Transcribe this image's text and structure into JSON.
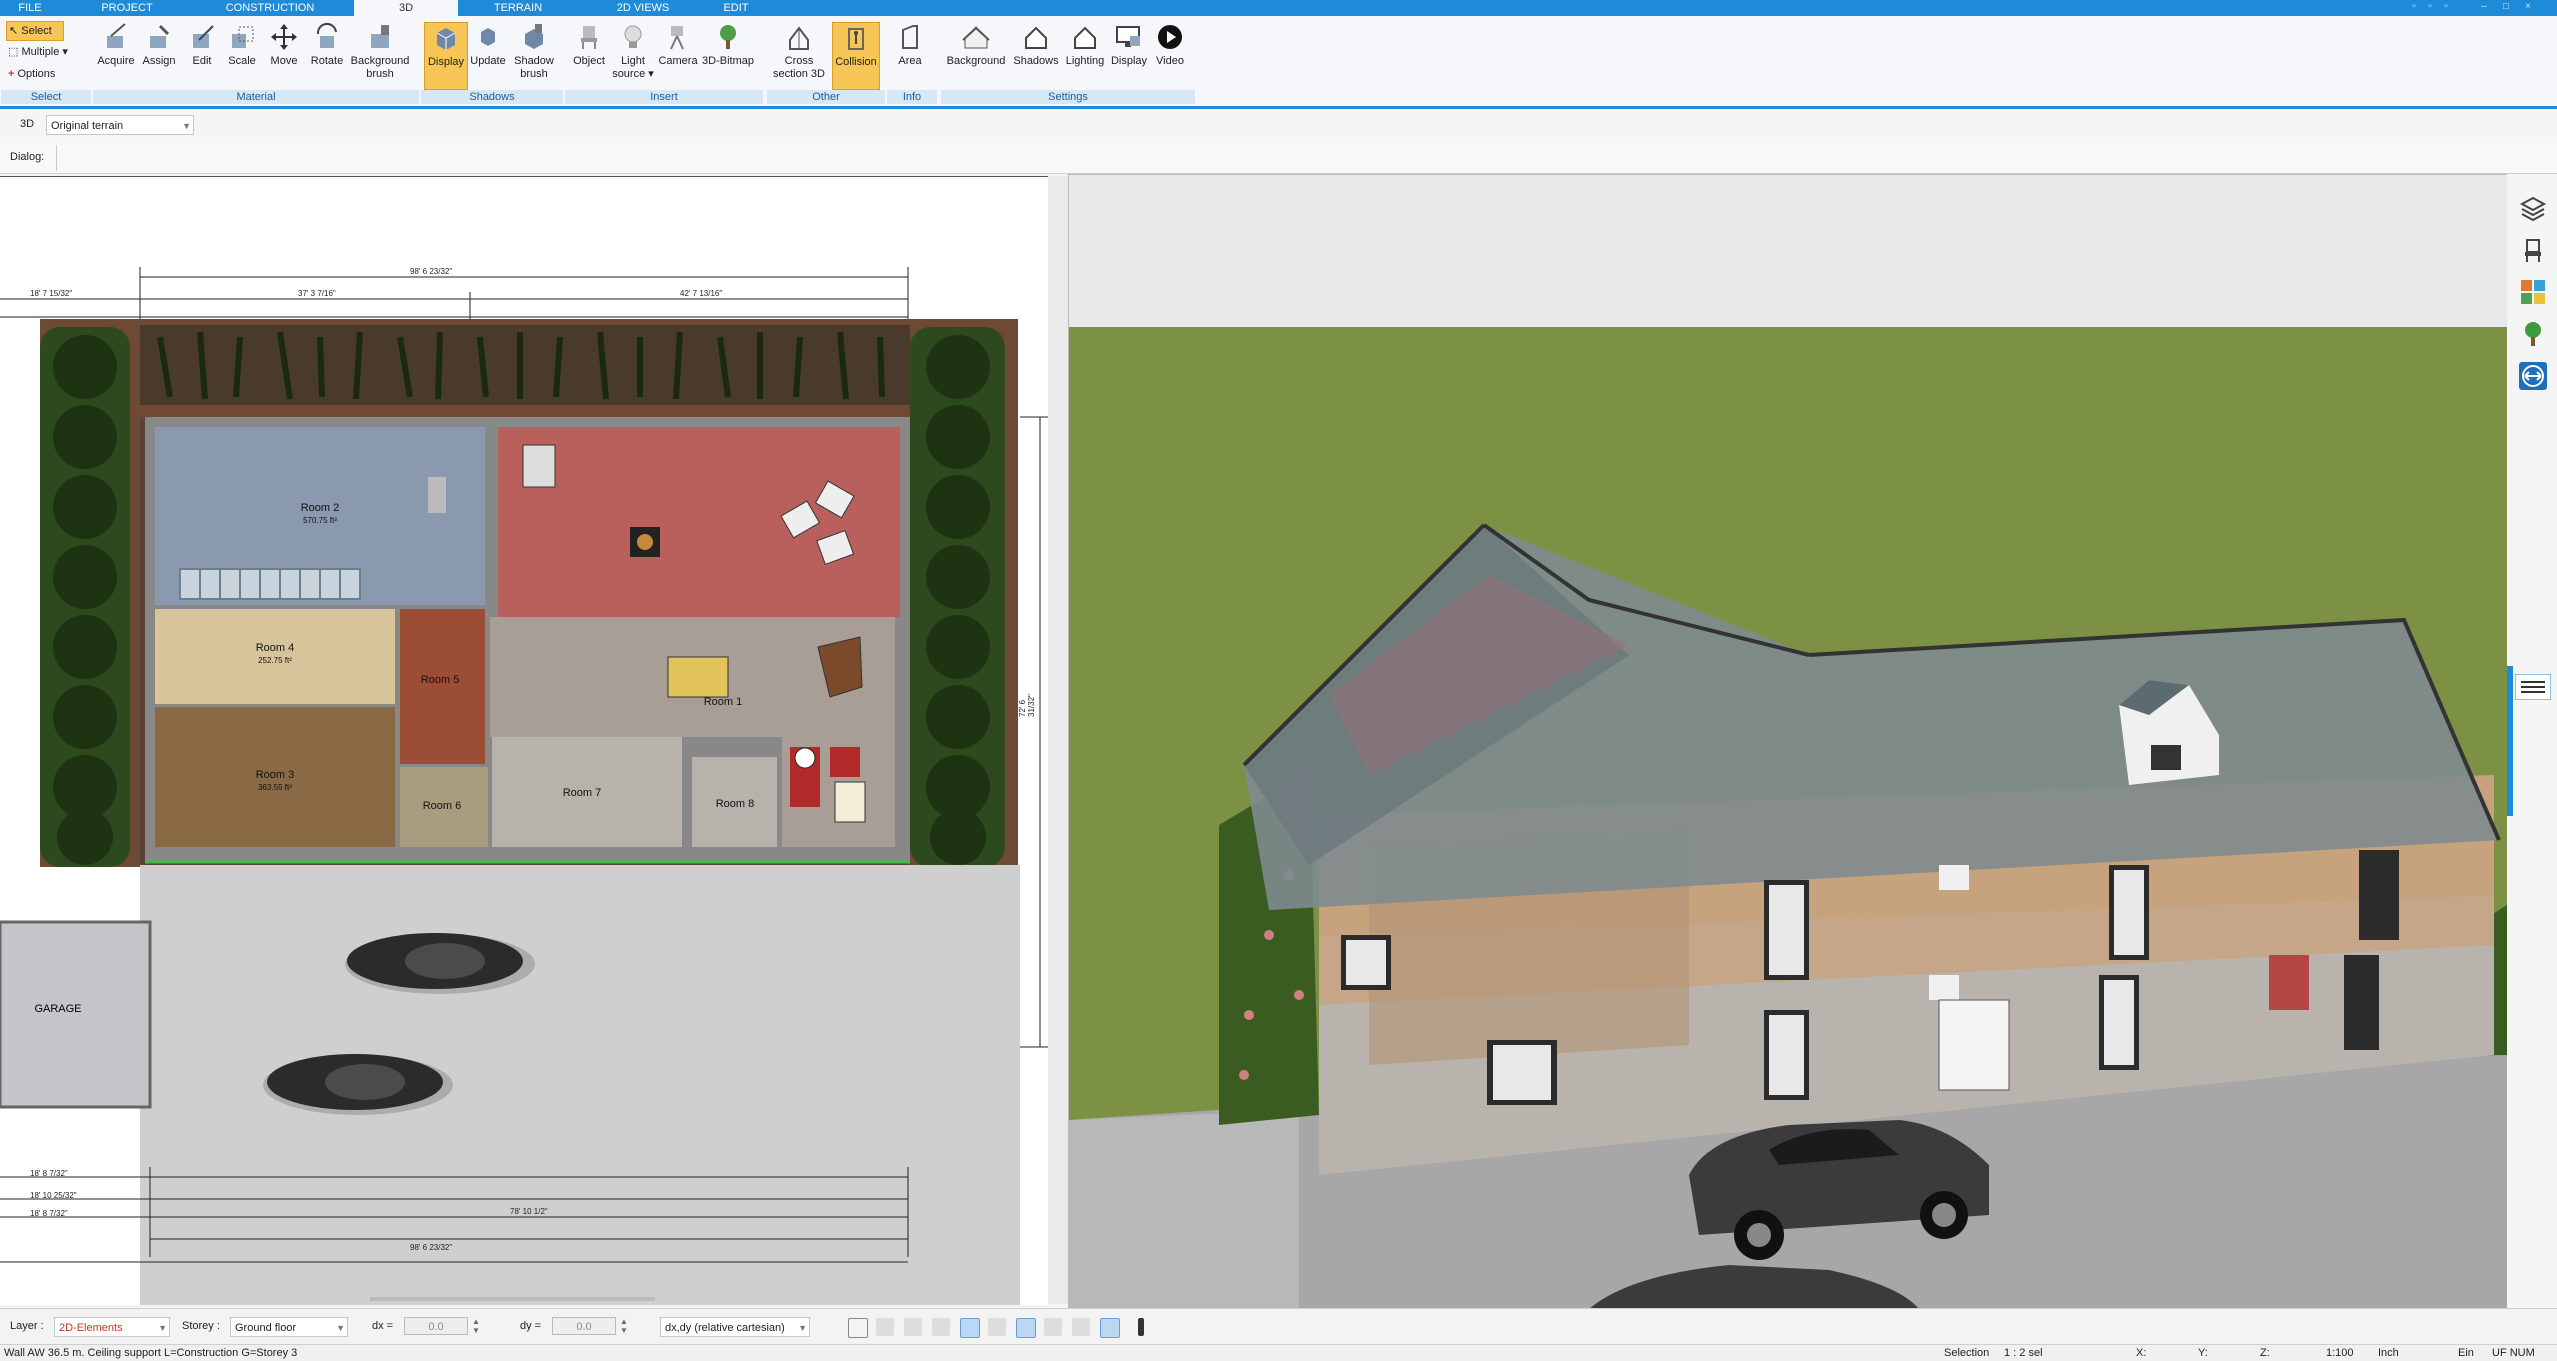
{
  "tabs": [
    {
      "label": "FILE"
    },
    {
      "label": "PROJECT"
    },
    {
      "label": "CONSTRUCTION"
    },
    {
      "label": "3D"
    },
    {
      "label": "TERRAIN"
    },
    {
      "label": "2D VIEWS"
    },
    {
      "label": "EDIT"
    }
  ],
  "ribbon": {
    "select_group": {
      "select": "Select",
      "multiple": "Multiple",
      "options": "Options",
      "group_label": "Select"
    },
    "material": {
      "acquire": "Acquire",
      "assign": "Assign",
      "edit": "Edit",
      "scale": "Scale",
      "move": "Move",
      "rotate": "Rotate",
      "background_brush_1": "Background",
      "background_brush_2": "brush",
      "group_label": "Material"
    },
    "shadows": {
      "display": "Display",
      "update": "Update",
      "shadow_brush_1": "Shadow",
      "shadow_brush_2": "brush",
      "group_label": "Shadows"
    },
    "insert": {
      "object": "Object",
      "light_source_1": "Light",
      "light_source_2": "source",
      "camera": "Camera",
      "bitmap": "3D-Bitmap",
      "group_label": "Insert"
    },
    "other": {
      "cross_1": "Cross",
      "cross_2": "section 3D",
      "collision": "Collision",
      "group_label": "Other"
    },
    "info": {
      "area": "Area",
      "group_label": "Info"
    },
    "settings": {
      "background": "Background",
      "shadows": "Shadows",
      "lighting": "Lighting",
      "display": "Display",
      "video": "Video",
      "group_label": "Settings"
    }
  },
  "optionbar": {
    "mode_label": "3D",
    "terrain_value": "Original terrain",
    "dialog_label": "Dialog:"
  },
  "plan": {
    "rooms": [
      {
        "name": "Room 2",
        "area": "570.75 ft²"
      },
      {
        "name": "Room 4",
        "area": "252.75 ft²"
      },
      {
        "name": "Room 3",
        "area": "363.55 ft²"
      },
      {
        "name": "Room 1",
        "area": "..."
      },
      {
        "name": "Room 5",
        "area": "..."
      },
      {
        "name": "Room 6",
        "area": "..."
      },
      {
        "name": "Room 7",
        "area": "..."
      },
      {
        "name": "Room 8",
        "area": "..."
      },
      {
        "name": "GARAGE",
        "area": "..."
      }
    ],
    "dims_top": [
      "98' 6 23/32\"",
      "18' 7 15/32\"",
      "37' 3 7/16\"",
      "42' 7 13/16\""
    ],
    "dims_bottom": [
      "18' 8 7/32\"",
      "98' 6 23/32\"",
      "78' 10 1/2\"",
      "18' 10 25/32\"",
      "18' 8 7/32\""
    ],
    "dim_right": "72' 6 31/32\""
  },
  "bottombar": {
    "layer_label": "Layer :",
    "layer_value": "2D-Elements",
    "storey_label": "Storey :",
    "storey_value": "Ground floor",
    "dx_label": "dx =",
    "dx_value": "0.0",
    "dy_label": "dy =",
    "dy_value": "0.0",
    "coord_mode": "dx,dy (relative cartesian)"
  },
  "status": {
    "message": "Wall AW 36.5 m. Ceiling support L=Construction G=Storey 3",
    "selection": "Selection",
    "scale": "1 : 2 sel",
    "x_label": "X:",
    "y_label": "Y:",
    "z_label": "Z:",
    "zoom": "1:100",
    "unit": "Inch",
    "ein": "Ein",
    "indicators": "UF NUM"
  },
  "colors": {
    "accent": "#1e8ad8",
    "active_button": "#f7c657",
    "grass": "#7d9145",
    "sky": "#e8e8e8"
  }
}
